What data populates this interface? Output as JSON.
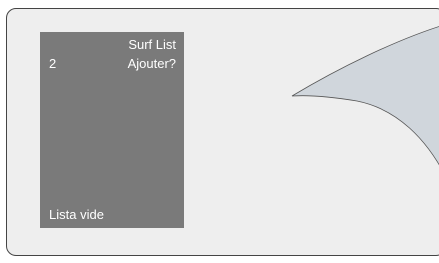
{
  "menu": {
    "title": "Surf List",
    "row": {
      "count": "2",
      "label": "Ajouter?"
    },
    "status": "Lista vide"
  },
  "colors": {
    "screen_background": "#eeeeee",
    "panel_background": "#7a7a7a",
    "panel_text": "#ffffff",
    "curl_fill": "#d0d6dc"
  }
}
